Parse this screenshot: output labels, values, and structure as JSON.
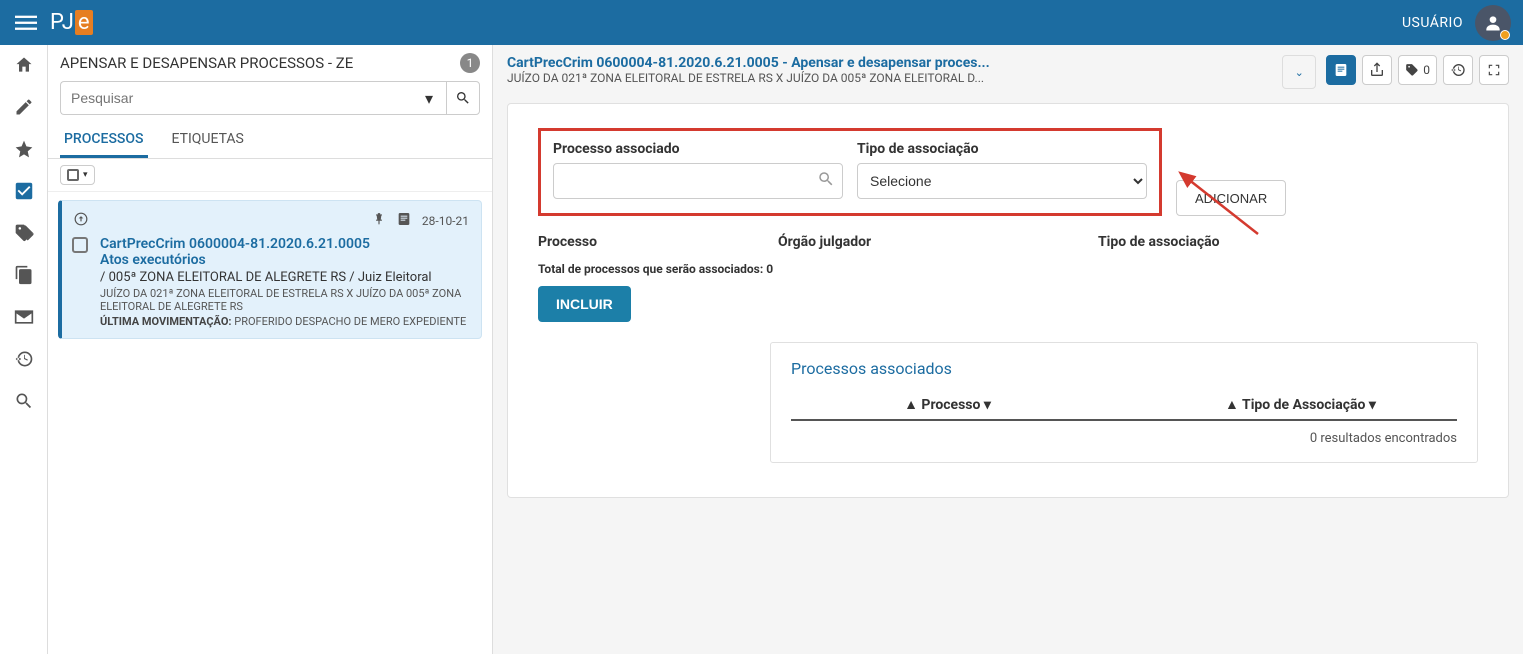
{
  "topbar": {
    "user_label": "USUÁRIO"
  },
  "sidebar": {
    "title": "APENSAR E DESAPENSAR PROCESSOS - ZE",
    "badge": "1",
    "search_placeholder": "Pesquisar",
    "tabs": {
      "processos": "PROCESSOS",
      "etiquetas": "ETIQUETAS"
    },
    "card": {
      "date": "28-10-21",
      "title": "CartPrecCrim 0600004-81.2020.6.21.0005",
      "line2": "Atos executórios",
      "line3": "/ 005ª ZONA ELEITORAL DE ALEGRETE RS / Juiz Eleitoral",
      "line4": "JUÍZO DA 021ª ZONA ELEITORAL DE ESTRELA RS X JUÍZO DA 005ª ZONA ELEITORAL DE ALEGRETE RS",
      "last_label": "ÚLTIMA MOVIMENTAÇÃO:",
      "last_value": "PROFERIDO DESPACHO DE MERO EXPEDIENTE"
    }
  },
  "main": {
    "title": "CartPrecCrim 0600004-81.2020.6.21.0005 - Apensar e desapensar proces...",
    "subtitle": "JUÍZO DA 021ª ZONA ELEITORAL DE ESTRELA RS X JUÍZO DA 005ª ZONA ELEITORAL D...",
    "tag_count": "0",
    "form": {
      "processo_label": "Processo associado",
      "tipo_label": "Tipo de associação",
      "select_placeholder": "Selecione",
      "add_btn": "ADICIONAR",
      "col_processo": "Processo",
      "col_orgao": "Órgão julgador",
      "col_tipo": "Tipo de associação",
      "total_prefix": "Total de processos que serão associados:",
      "total_value": "0",
      "incluir": "INCLUIR"
    },
    "assoc": {
      "title": "Processos associados",
      "col1": "Processo",
      "col2": "Tipo de Associação",
      "empty": "0 resultados encontrados"
    }
  }
}
